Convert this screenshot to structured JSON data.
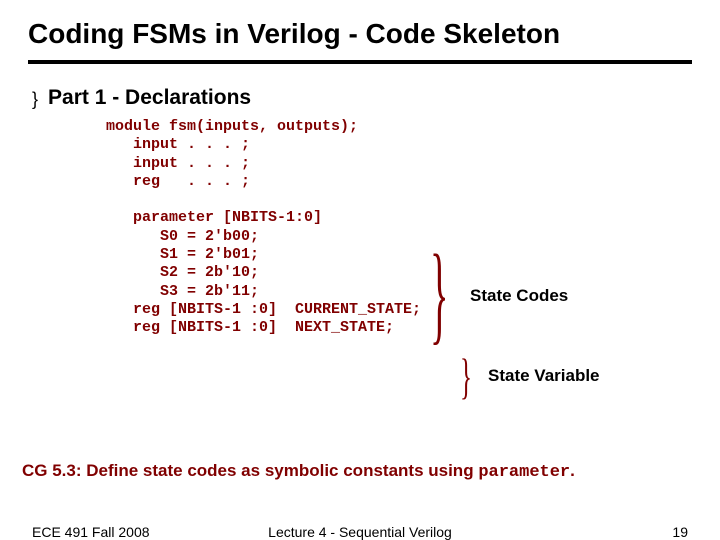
{
  "title": "Coding FSMs in Verilog - Code Skeleton",
  "section": "Part 1 - Declarations",
  "code": "module fsm(inputs, outputs);\n   input . . . ;\n   input . . . ;\n   reg   . . . ;\n\n   parameter [NBITS-1:0]\n      S0 = 2'b00;\n      S1 = 2'b01;\n      S2 = 2b'10;\n      S3 = 2b'11;\n   reg [NBITS-1 :0]  CURRENT_STATE;\n   reg [NBITS-1 :0]  NEXT_STATE;",
  "annot1": "State Codes",
  "annot2": "State Variable",
  "guideline_prefix": "CG 5.3:  Define state codes as symbolic constants using ",
  "guideline_param": "parameter",
  "guideline_suffix": ".",
  "footer_left": "ECE 491 Fall 2008",
  "footer_center": "Lecture 4 - Sequential Verilog",
  "footer_right": "19"
}
